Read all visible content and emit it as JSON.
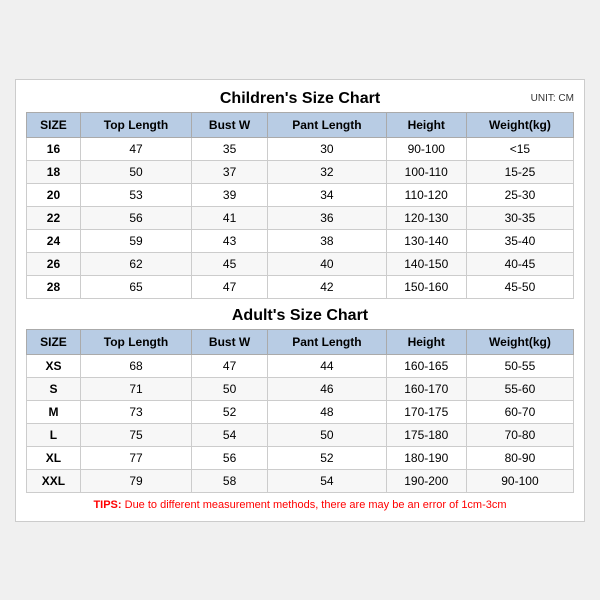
{
  "children": {
    "title": "Children's Size Chart",
    "unit": "UNIT: CM",
    "headers": [
      "SIZE",
      "Top Length",
      "Bust W",
      "Pant Length",
      "Height",
      "Weight(kg)"
    ],
    "rows": [
      [
        "16",
        "47",
        "35",
        "30",
        "90-100",
        "<15"
      ],
      [
        "18",
        "50",
        "37",
        "32",
        "100-110",
        "15-25"
      ],
      [
        "20",
        "53",
        "39",
        "34",
        "110-120",
        "25-30"
      ],
      [
        "22",
        "56",
        "41",
        "36",
        "120-130",
        "30-35"
      ],
      [
        "24",
        "59",
        "43",
        "38",
        "130-140",
        "35-40"
      ],
      [
        "26",
        "62",
        "45",
        "40",
        "140-150",
        "40-45"
      ],
      [
        "28",
        "65",
        "47",
        "42",
        "150-160",
        "45-50"
      ]
    ]
  },
  "adults": {
    "title": "Adult's Size Chart",
    "headers": [
      "SIZE",
      "Top Length",
      "Bust W",
      "Pant Length",
      "Height",
      "Weight(kg)"
    ],
    "rows": [
      [
        "XS",
        "68",
        "47",
        "44",
        "160-165",
        "50-55"
      ],
      [
        "S",
        "71",
        "50",
        "46",
        "160-170",
        "55-60"
      ],
      [
        "M",
        "73",
        "52",
        "48",
        "170-175",
        "60-70"
      ],
      [
        "L",
        "75",
        "54",
        "50",
        "175-180",
        "70-80"
      ],
      [
        "XL",
        "77",
        "56",
        "52",
        "180-190",
        "80-90"
      ],
      [
        "XXL",
        "79",
        "58",
        "54",
        "190-200",
        "90-100"
      ]
    ]
  },
  "tips": {
    "label": "TIPS:",
    "text": " Due to different measurement methods, there are may be an error of 1cm-3cm"
  }
}
